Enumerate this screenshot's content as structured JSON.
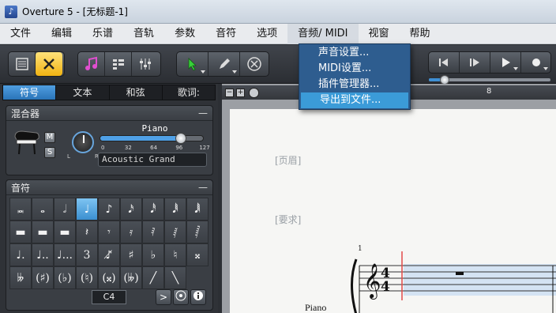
{
  "window": {
    "title": "Overture 5 - [无标题-1]"
  },
  "menu": {
    "items": [
      "文件",
      "编辑",
      "乐谱",
      "音轨",
      "参数",
      "音符",
      "选项",
      "音频/ MIDI",
      "视窗",
      "帮助"
    ],
    "active_index": 7
  },
  "audio_menu": {
    "items": [
      "声音设置...",
      "MIDI设置...",
      "插件管理器...",
      "导出到文件..."
    ],
    "selected_index": 3
  },
  "palette_tabs": {
    "items": [
      "符号",
      "文本",
      "和弦",
      "歌词:"
    ],
    "active_index": 0
  },
  "mixer": {
    "title": "混合器",
    "collapse": "—",
    "instrument": "Piano",
    "mute_label": "M",
    "solo_label": "S",
    "pan_left": "L",
    "pan_right": "R",
    "volume": 100,
    "scale": [
      "0",
      "32",
      "64",
      "96",
      "127"
    ],
    "patch": "Acoustic Grand"
  },
  "notes_panel": {
    "title": "音符",
    "collapse": "—",
    "pitch_value": "C4",
    "selected_cell": 3,
    "cells": [
      "𝅜",
      "𝅝",
      "𝅗𝅥",
      "♩",
      "♪",
      "𝅘𝅥𝅯",
      "𝅘𝅥𝅰",
      "𝅘𝅥𝅱",
      "𝅘𝅥𝅲",
      "▬",
      "▬",
      "▬",
      "𝄽",
      "𝄾",
      "𝄿",
      "𝅀",
      "𝅁",
      "𝅂",
      "♩.",
      "♩..",
      "♩...",
      "3",
      "♪̸",
      "♯",
      "♭",
      "♮",
      "𝄪",
      "𝄫",
      "(♯)",
      "(♭)",
      "(♮)",
      "(𝄪)",
      "(𝄫)",
      "╱",
      "╲"
    ]
  },
  "score": {
    "ruler_number": "8",
    "header_placeholder": "[页眉]",
    "requirement_placeholder": "[要求]",
    "measure_number": "1",
    "part_name": "Piano",
    "time_signature": [
      "4",
      "4"
    ]
  },
  "colors": {
    "accent": "#3b9bd8",
    "menu_popup": "#2e5d8f",
    "selection": "#d4e3f3",
    "cursor": "#e24a4a"
  }
}
